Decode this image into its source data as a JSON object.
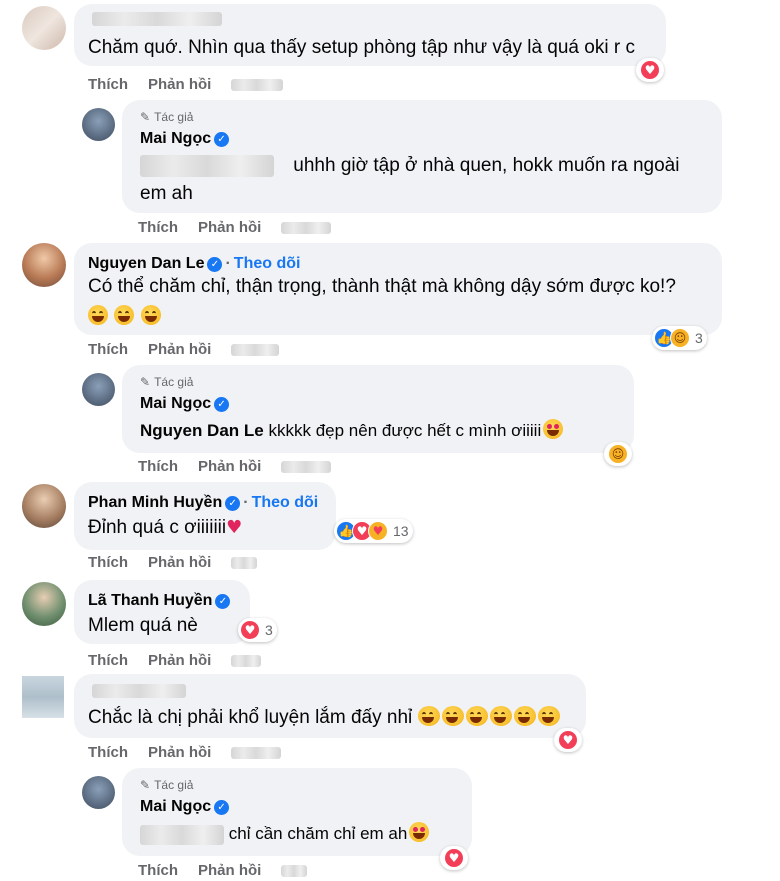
{
  "labels": {
    "like": "Thích",
    "reply": "Phản hồi",
    "author": "Tác giả",
    "follow": "Theo dõi"
  },
  "comments": [
    {
      "text": "Chăm quớ. Nhìn qua thấy setup phòng tập như vậy là quá oki r c"
    },
    {
      "name": "Mai Ngọc",
      "text": "uhhh giờ tập ở nhà quen, hokk muốn ra ngoài",
      "text2": "em ah"
    },
    {
      "name": "Nguyen Dan Le",
      "text": "Có thể chăm chỉ, thận trọng, thành thật mà không dậy sớm được ko!?",
      "reactions": "3"
    },
    {
      "name": "Mai Ngọc",
      "mention": "Nguyen Dan Le",
      "text": "kkkkk đẹp nên được hết c mình ơiiiii"
    },
    {
      "name": "Phan Minh Huyền",
      "text": "Đỉnh quá c ơiiiiiii",
      "reactions": "13"
    },
    {
      "name": "Lã Thanh Huyền",
      "text": "Mlem quá nè",
      "reactions": "3"
    },
    {
      "text": "Chắc là chị phải khổ luyện lắm đấy nhỉ"
    },
    {
      "name": "Mai Ngọc",
      "text": "chỉ cần chăm chỉ em ah"
    }
  ],
  "colors": {
    "bubble": "#f0f2f5",
    "accent": "#1877f2",
    "love": "#f33e58",
    "meta": "#65676b"
  },
  "icons": [
    "verified-badge-icon",
    "pen-icon",
    "like-reaction-icon",
    "love-reaction-icon",
    "haha-reaction-icon",
    "care-reaction-icon"
  ]
}
